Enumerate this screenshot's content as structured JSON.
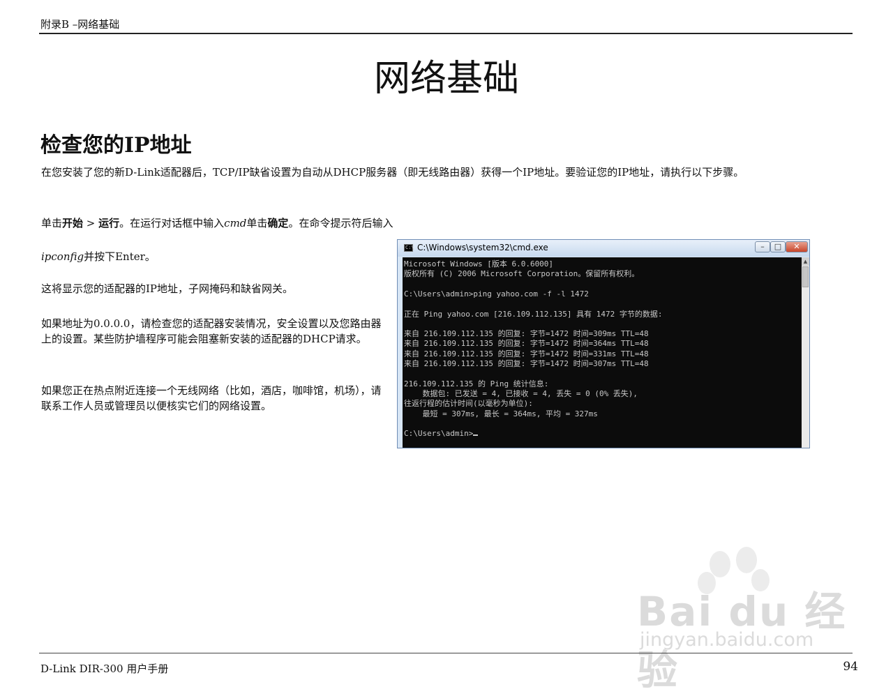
{
  "header": {
    "section": "附录B –网络基础"
  },
  "title": "网络基础",
  "section_heading": "检查您的IP地址",
  "paragraphs": {
    "intro": "在您安装了您的新D-Link适配器后，TCP/IP缺省设置为自动从DHCP服务器（即无线路由器）获得一个IP地址。要验证您的IP地址，请执行以下步骤。",
    "step1": {
      "a": "单击",
      "b": "开始",
      "c": " > ",
      "d": "运行",
      "e": "。在运行对话框中输入",
      "f": "cmd",
      "g": "单击",
      "h": "确定",
      "i": "。在命令提示符后输入"
    },
    "step2": {
      "a": "ipconfig",
      "b": "并按下Enter。"
    },
    "step3": "这将显示您的适配器的IP地址，子网掩码和缺省网关。",
    "step4": "如果地址为0.0.0.0，请检查您的适配器安装情况，安全设置以及您路由器上的设置。某些防护墙程序可能会阻塞新安装的适配器的DHCP请求。",
    "step5": "如果您正在热点附近连接一个无线网络（比如，酒店，咖啡馆，机场），请联系工作人员或管理员以便核实它们的网络设置。"
  },
  "cmd_window": {
    "title": "C:\\Windows\\system32\\cmd.exe",
    "lines": [
      "Microsoft Windows [版本 6.0.6000]",
      "版权所有 (C) 2006 Microsoft Corporation。保留所有权利。",
      "",
      "C:\\Users\\admin>ping yahoo.com -f -l 1472",
      "",
      "正在 Ping yahoo.com [216.109.112.135] 具有 1472 字节的数据:",
      "",
      "来自 216.109.112.135 的回复: 字节=1472 时间=309ms TTL=48",
      "来自 216.109.112.135 的回复: 字节=1472 时间=364ms TTL=48",
      "来自 216.109.112.135 的回复: 字节=1472 时间=331ms TTL=48",
      "来自 216.109.112.135 的回复: 字节=1472 时间=307ms TTL=48",
      "",
      "216.109.112.135 的 Ping 统计信息:",
      "    数据包: 已发送 = 4, 已接收 = 4, 丢失 = 0 (0% 丢失),",
      "往返行程的估计时间(以毫秒为单位):",
      "    最短 = 307ms, 最长 = 364ms, 平均 = 327ms",
      "",
      "C:\\Users\\admin>"
    ]
  },
  "watermark": {
    "brand": "Bai du 经验",
    "url": "jingyan.baidu.com"
  },
  "footer": {
    "manual": "D-Link DIR-300 用户手册",
    "page": "94"
  }
}
